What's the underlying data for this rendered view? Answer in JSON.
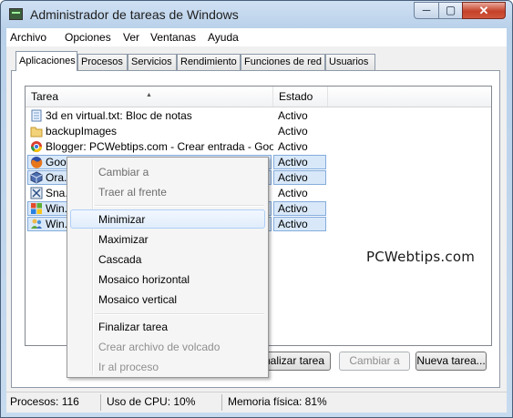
{
  "window": {
    "title": "Administrador de tareas de Windows",
    "min_label": "─",
    "max_label": "▢",
    "close_label": "✕"
  },
  "menu": [
    "Archivo",
    "Opciones",
    "Ver",
    "Ventanas",
    "Ayuda"
  ],
  "tabs": [
    "Aplicaciones",
    "Procesos",
    "Servicios",
    "Rendimiento",
    "Funciones de red",
    "Usuarios"
  ],
  "list": {
    "columns": [
      "Tarea",
      "Estado"
    ],
    "rows": [
      {
        "name": "3d en virtual.txt: Bloc de notas",
        "status": "Activo",
        "icon": "notepad-icon",
        "selected": false
      },
      {
        "name": "backupImages",
        "status": "Activo",
        "icon": "folder-icon",
        "selected": false
      },
      {
        "name": "Blogger: PCWebtips.com - Crear entrada - Googl...",
        "status": "Activo",
        "icon": "chrome-icon",
        "selected": false
      },
      {
        "name": "Goo...",
        "status": "Activo",
        "icon": "firefox-icon",
        "selected": true
      },
      {
        "name": "Ora...",
        "status": "Activo",
        "icon": "virtualbox-icon",
        "selected": true
      },
      {
        "name": "Sna...",
        "status": "Activo",
        "icon": "snagit-icon",
        "selected": false
      },
      {
        "name": "Win...",
        "status": "Activo",
        "icon": "windows-icon",
        "selected": true
      },
      {
        "name": "Win...",
        "status": "Activo",
        "icon": "users-icon",
        "selected": true
      }
    ]
  },
  "watermark": "PCWebtips.com",
  "buttons": {
    "end_task": "Finalizar tarea",
    "switch_to": "Cambiar a",
    "new_task": "Nueva tarea..."
  },
  "status": {
    "processes": "Procesos: 116",
    "cpu": "Uso de CPU: 10%",
    "memory": "Memoria física: 81%"
  },
  "context_menu": {
    "switch_to": "Cambiar a",
    "bring_to_front": "Traer al frente",
    "minimize": "Minimizar",
    "maximize": "Maximizar",
    "cascade": "Cascada",
    "tile_horizontal": "Mosaico horizontal",
    "tile_vertical": "Mosaico vertical",
    "end_task": "Finalizar tarea",
    "create_dump": "Crear archivo de volcado",
    "go_to_process": "Ir al proceso"
  },
  "colors": {
    "selection": "#d8e8f9",
    "selection_border": "#84acdd",
    "close_button": "#c5412a"
  }
}
